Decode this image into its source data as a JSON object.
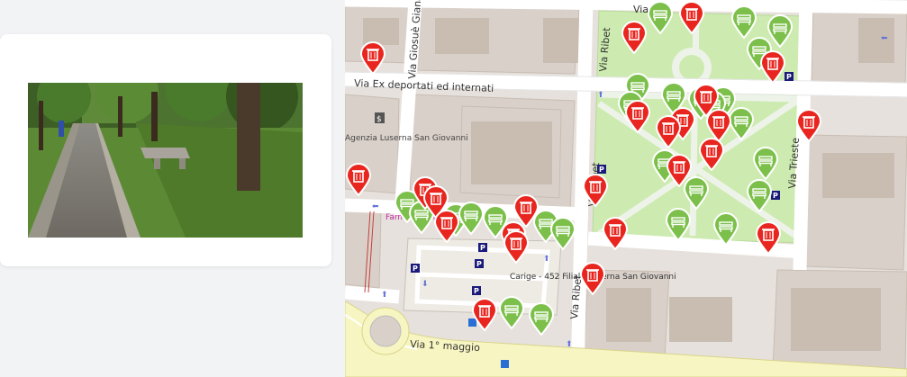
{
  "photo": {
    "description_icon": "park-path-photo"
  },
  "map": {
    "streets": [
      {
        "id": "via-ex-deportati",
        "label": "Via Ex deportati ed internati"
      },
      {
        "id": "via-giosue-giana",
        "label": "Via Giosuè Giana"
      },
      {
        "id": "via-ribet-north",
        "label": "Via Ribet"
      },
      {
        "id": "via-ribet-mid",
        "label": "Via Ribet"
      },
      {
        "id": "via-ribet-south",
        "label": "Via Ribet"
      },
      {
        "id": "via-trieste",
        "label": "Via Trieste"
      },
      {
        "id": "via-1-maggio",
        "label": "Via 1° maggio"
      },
      {
        "id": "via-top",
        "label": "Via"
      }
    ],
    "pois": [
      {
        "id": "agenzia",
        "label": "Agenzia Luserna San Giovanni"
      },
      {
        "id": "farmacia",
        "label": "Farm. Vasario"
      },
      {
        "id": "carige",
        "label": "Carige - 452 Filiale Luserna San Giovanni"
      }
    ],
    "colors": {
      "trash_marker": "#e8261f",
      "bench_marker": "#7cc04b",
      "park_green": "#cdebb0",
      "building": "#d9d0c9",
      "parking_blue": "#1a1a7a"
    },
    "markers": [
      {
        "type": "trash",
        "icon": "trash-bin-icon"
      },
      {
        "type": "bench",
        "icon": "bench-icon"
      }
    ]
  }
}
